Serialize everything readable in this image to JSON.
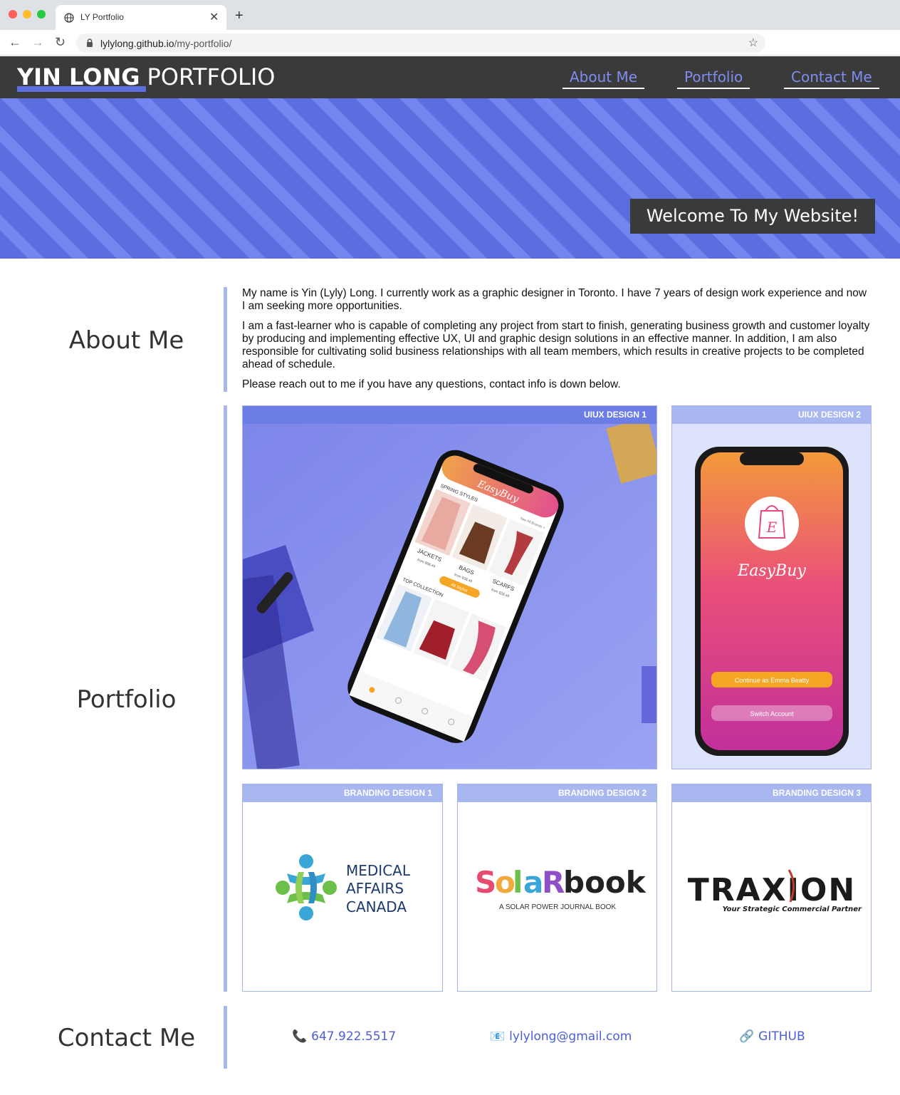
{
  "browser": {
    "tab_title": "LY Portfolio",
    "url_host": "lylylong.github.io",
    "url_path": "/my-portfolio/"
  },
  "header": {
    "brand_strong": "YIN LONG",
    "brand_light": "PORTFOLIO",
    "nav": [
      {
        "label": "About Me"
      },
      {
        "label": "Portfolio"
      },
      {
        "label": "Contact Me"
      }
    ]
  },
  "hero": {
    "welcome": "Welcome To My Website!"
  },
  "about": {
    "title": "About Me",
    "paragraphs": [
      "My name is Yin (Lyly) Long. I currently work as a graphic designer in Toronto. I have 7 years of design work experience and now I am seeking more opportunities.",
      "I am a fast-learner who is capable of completing any project from start to finish, generating business growth and customer loyalty by producing and implementing effective UX, UI and graphic design solutions in an effective manner. In addition, I am also responsible for cultivating solid business relationships with all team members, which results in creative projects to be completed ahead of schedule.",
      "Please reach out to me if you have any questions, contact info is down below."
    ]
  },
  "portfolio": {
    "title": "Portfolio",
    "cards": [
      {
        "label": "UIUX DESIGN 1"
      },
      {
        "label": "UIUX DESIGN 2"
      },
      {
        "label": "BRANDING DESIGN 1"
      },
      {
        "label": "BRANDING DESIGN 2"
      },
      {
        "label": "BRANDING DESIGN 3"
      }
    ],
    "app1": {
      "brand": "EasyBuy",
      "section1": "SPRING STYLES",
      "see_all": "See All Brands >",
      "items": [
        "JACKETS",
        "BAGS",
        "SCARFS"
      ],
      "prices": [
        "from $68.49",
        "from $38.49",
        "from $28.49"
      ],
      "button": "All Styles",
      "section2": "TOP COLLECTION"
    },
    "app2": {
      "brand": "EasyBuy",
      "logo_letter": "E",
      "btn_primary": "Continue as Emma Beatty",
      "btn_secondary": "Switch Account"
    },
    "logos": {
      "mac": [
        "MEDICAL",
        "AFFAIRS",
        "CANADA"
      ],
      "solar_title": "SOLARBOOK",
      "solar_sub": "A SOLAR POWER JOURNAL BOOK",
      "traxion_title": "TRAXION",
      "traxion_sub": "Your Strategic Commercial Partner"
    }
  },
  "contact": {
    "title": "Contact Me",
    "phone": "647.922.5517",
    "email": "lylylong@gmail.com",
    "github": "GITHUB"
  }
}
